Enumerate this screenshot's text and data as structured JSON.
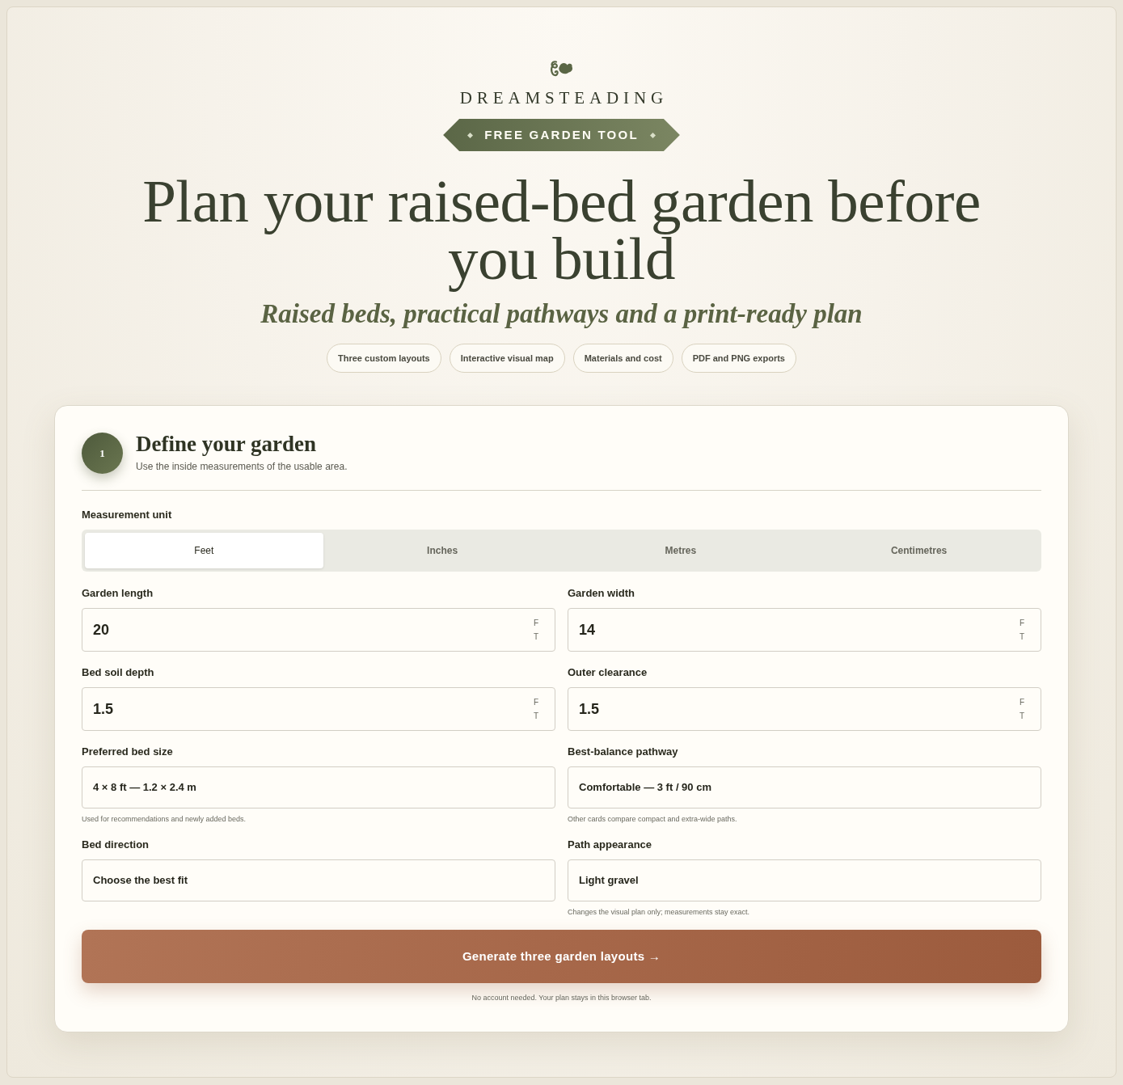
{
  "brand": {
    "name": "DREAMSTEADING",
    "badge": "FREE GARDEN TOOL"
  },
  "hero": {
    "title": "Plan your raised-bed garden before you build",
    "subtitle": "Raised beds, practical pathways and a print-ready plan",
    "features": [
      "Three custom layouts",
      "Interactive visual map",
      "Materials and cost",
      "PDF and PNG exports"
    ]
  },
  "form": {
    "step": "1",
    "title": "Define your garden",
    "description": "Use the inside measurements of the usable area.",
    "unit_label": "Measurement unit",
    "units": [
      {
        "label": "Feet",
        "selected": true
      },
      {
        "label": "Inches",
        "selected": false
      },
      {
        "label": "Metres",
        "selected": false
      },
      {
        "label": "Centimetres",
        "selected": false
      }
    ],
    "fields": [
      {
        "kind": "number",
        "label": "Garden length",
        "value": "20",
        "unit": "FT"
      },
      {
        "kind": "number",
        "label": "Garden width",
        "value": "14",
        "unit": "FT"
      },
      {
        "kind": "number",
        "label": "Bed soil depth",
        "value": "1.5",
        "unit": "FT"
      },
      {
        "kind": "number",
        "label": "Outer clearance",
        "value": "1.5",
        "unit": "FT"
      },
      {
        "kind": "select",
        "label": "Preferred bed size",
        "value": "4 × 8 ft — 1.2 × 2.4 m",
        "hint": "Used for recommendations and newly added beds."
      },
      {
        "kind": "select",
        "label": "Best-balance pathway",
        "value": "Comfortable — 3 ft / 90 cm",
        "hint": "Other cards compare compact and extra-wide paths."
      },
      {
        "kind": "select",
        "label": "Bed direction",
        "value": "Choose the best fit"
      },
      {
        "kind": "select",
        "label": "Path appearance",
        "value": "Light gravel",
        "hint": "Changes the visual plan only; measurements stay exact."
      }
    ],
    "submit": "Generate three garden layouts →",
    "note": "No account needed. Your plan stays in this browser tab."
  }
}
